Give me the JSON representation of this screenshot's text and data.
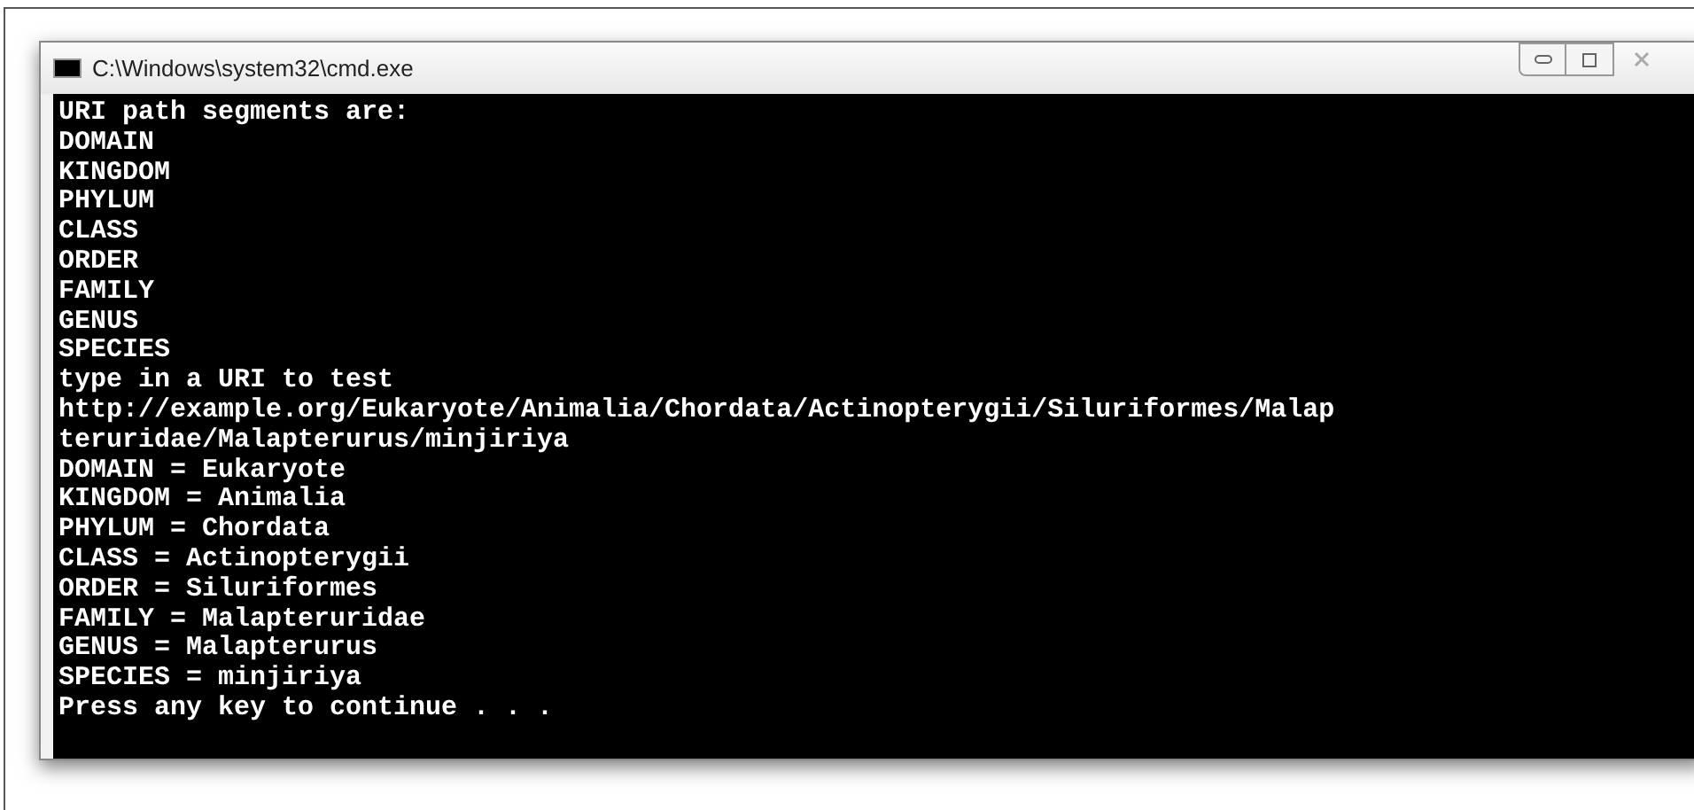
{
  "window": {
    "title": "C:\\Windows\\system32\\cmd.exe"
  },
  "console": {
    "lines": [
      "URI path segments are:",
      "DOMAIN",
      "KINGDOM",
      "PHYLUM",
      "CLASS",
      "ORDER",
      "FAMILY",
      "GENUS",
      "SPECIES",
      "type in a URI to test",
      "http://example.org/Eukaryote/Animalia/Chordata/Actinopterygii/Siluriformes/Malap",
      "teruridae/Malapterurus/minjiriya",
      "DOMAIN = Eukaryote",
      "KINGDOM = Animalia",
      "PHYLUM = Chordata",
      "CLASS = Actinopterygii",
      "ORDER = Siluriformes",
      "FAMILY = Malapteruridae",
      "GENUS = Malapterurus",
      "SPECIES = minjiriya",
      "Press any key to continue . . ."
    ]
  }
}
